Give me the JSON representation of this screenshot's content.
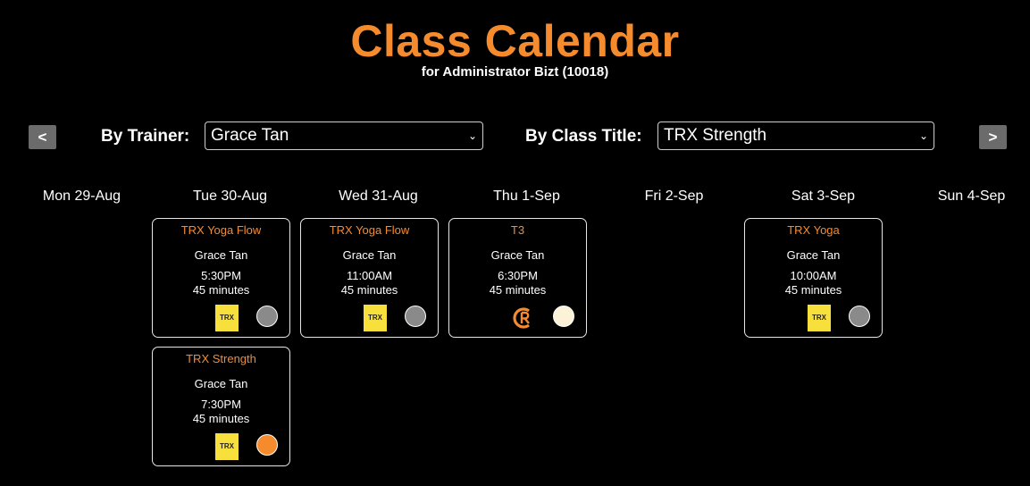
{
  "header": {
    "title": "Class Calendar",
    "subtitle": "for Administrator Bizt (10018)"
  },
  "nav": {
    "prev_label": "<",
    "next_label": ">"
  },
  "filters": {
    "trainer_label": "By Trainer:",
    "trainer_value": "Grace Tan",
    "class_label": "By Class Title:",
    "class_value": "TRX Strength"
  },
  "days": [
    {
      "label": "Mon 29-Aug"
    },
    {
      "label": "Tue 30-Aug"
    },
    {
      "label": "Wed 31-Aug"
    },
    {
      "label": "Thu 1-Sep"
    },
    {
      "label": "Fri 2-Sep"
    },
    {
      "label": "Sat 3-Sep"
    },
    {
      "label": "Sun 4-Sep"
    }
  ],
  "classes": [
    {
      "title": "TRX Yoga Flow",
      "trainer": "Grace Tan",
      "time": "5:30PM",
      "duration": "45 minutes",
      "logo_text": "TRX",
      "logo_icon": "trx-logo-icon",
      "status_color": "#8a8a8a"
    },
    {
      "title": "TRX Strength",
      "trainer": "Grace Tan",
      "time": "7:30PM",
      "duration": "45 minutes",
      "logo_text": "TRX",
      "logo_icon": "trx-logo-icon",
      "status_color": "#f68b2e"
    },
    {
      "title": "TRX Yoga Flow",
      "trainer": "Grace Tan",
      "time": "11:00AM",
      "duration": "45 minutes",
      "logo_text": "TRX",
      "logo_icon": "trx-logo-icon",
      "status_color": "#8a8a8a"
    },
    {
      "title": "T3",
      "trainer": "Grace Tan",
      "time": "6:30PM",
      "duration": "45 minutes",
      "logo_icon": "cr-logo-icon",
      "status_color": "#fbf2d8"
    },
    {
      "title": "TRX Yoga",
      "trainer": "Grace Tan",
      "time": "10:00AM",
      "duration": "45 minutes",
      "logo_text": "TRX",
      "logo_icon": "trx-logo-icon",
      "status_color": "#8a8a8a"
    }
  ],
  "colors": {
    "accent": "#f68b2e",
    "background": "#000000",
    "trx_yellow": "#f7e03c"
  }
}
